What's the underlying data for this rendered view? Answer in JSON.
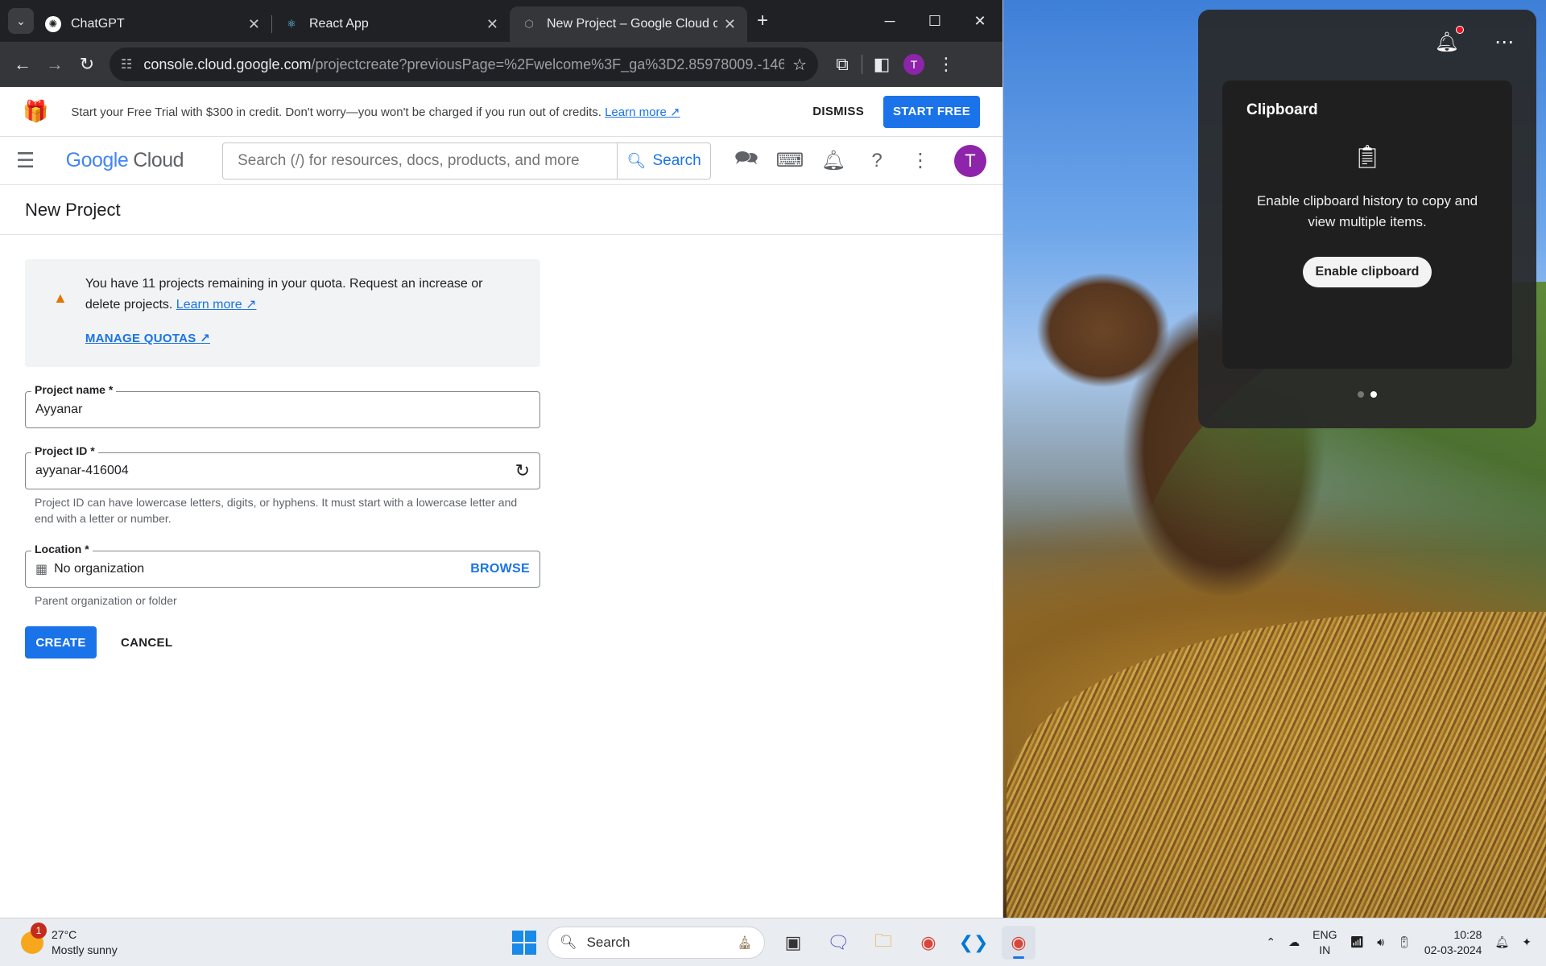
{
  "browser": {
    "tabs": [
      {
        "title": "ChatGPT",
        "icon": "chatgpt-icon"
      },
      {
        "title": "React App",
        "icon": "react-icon"
      },
      {
        "title": "New Project – Google Cloud co",
        "icon": "google-cloud-icon",
        "active": true
      }
    ],
    "url_host": "console.cloud.google.com",
    "url_path": "/projectcreate?previousPage=%2Fwelcome%3F_ga%3D2.85978009.-1464...",
    "profile_initial": "T"
  },
  "banner": {
    "message": "Start your Free Trial with $300 in credit. Don't worry—you won't be charged if you run out of credits.",
    "learn_more": "Learn more",
    "dismiss": "DISMISS",
    "start_free": "START FREE"
  },
  "header": {
    "logo_google": "Google",
    "logo_cloud": "Cloud",
    "search_placeholder": "Search (/) for resources, docs, products, and more",
    "search_button": "Search",
    "avatar_initial": "T"
  },
  "page": {
    "title": "New Project",
    "quota_message": "You have 11 projects remaining in your quota. Request an increase or delete projects.",
    "quota_learn_more": "Learn more",
    "manage_quotas": "MANAGE QUOTAS",
    "project_name_label": "Project name *",
    "project_name_value": "Ayyanar",
    "project_id_label": "Project ID *",
    "project_id_value": "ayyanar-416004",
    "project_id_hint": "Project ID can have lowercase letters, digits, or hyphens. It must start with a lowercase letter and end with a letter or number.",
    "location_label": "Location *",
    "location_value": "No organization",
    "browse": "BROWSE",
    "location_hint": "Parent organization or folder",
    "create": "CREATE",
    "cancel": "CANCEL"
  },
  "clipboard": {
    "title": "Clipboard",
    "message": "Enable clipboard history to copy and view multiple items.",
    "button": "Enable clipboard"
  },
  "taskbar": {
    "weather_temp": "27°C",
    "weather_desc": "Mostly sunny",
    "weather_badge": "1",
    "search_label": "Search",
    "lang_1": "ENG",
    "lang_2": "IN",
    "time": "10:28",
    "date": "02-03-2024"
  },
  "colors": {
    "accent": "#1a73e8",
    "avatar": "#8e24aa",
    "warning": "#e37400"
  }
}
